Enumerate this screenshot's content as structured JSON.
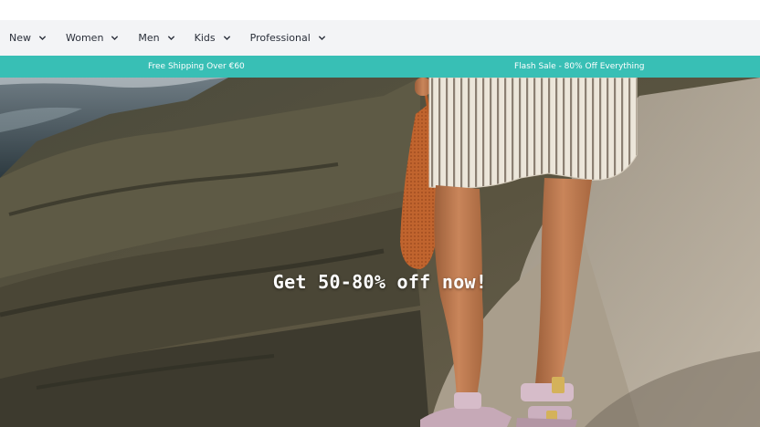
{
  "nav": {
    "items": [
      {
        "label": "New"
      },
      {
        "label": "Women"
      },
      {
        "label": "Men"
      },
      {
        "label": "Kids"
      },
      {
        "label": "Professional"
      }
    ]
  },
  "promo": {
    "left_text": "Free Shipping Over €60",
    "right_text": "Flash Sale - 80% Off  Everything",
    "background": "#38bfb5"
  },
  "hero": {
    "headline": "Get 50-80% off now!"
  },
  "colors": {
    "nav_background": "#f3f4f6",
    "accent": "#38bfb5"
  }
}
